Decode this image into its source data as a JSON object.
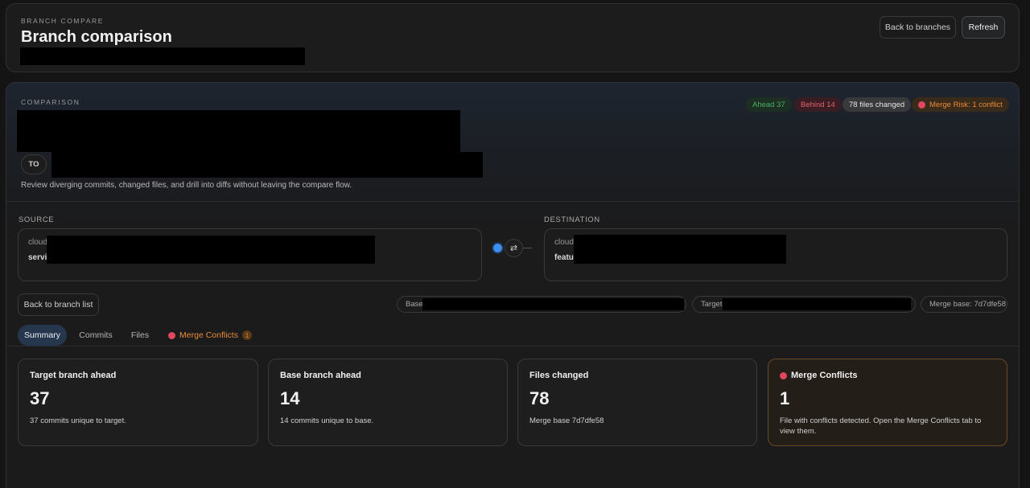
{
  "header": {
    "eyebrow": "BRANCH COMPARE",
    "title": "Branch comparison",
    "back_label": "Back to branches",
    "refresh_label": "Refresh"
  },
  "comparison": {
    "eyebrow": "COMPARISON",
    "to_label": "TO",
    "description": "Review diverging commits, changed files, and drill into diffs without leaving the compare flow.",
    "badges": {
      "ahead": "Ahead 37",
      "behind": "Behind 14",
      "files_changed": "78 files changed",
      "merge_risk": "Merge Risk: 1 conflict"
    },
    "colors": {
      "ahead": "#4caf68",
      "behind": "#e0616e",
      "risk": "#e88a3a",
      "active_tab": "#26374d",
      "node": "#3a8ff0"
    }
  },
  "source": {
    "label": "SOURCE",
    "line1": "cloud",
    "line2": "servic"
  },
  "destination": {
    "label": "DESTINATION",
    "line1": "cloud-",
    "line2": "featur"
  },
  "swap_icon": "swap-icon",
  "toolbar": {
    "back_list_label": "Back to branch list",
    "base_label": "Base:",
    "target_label": "Target:",
    "merge_base": "Merge base: 7d7dfe58"
  },
  "tabs": [
    {
      "label": "Summary"
    },
    {
      "label": "Commits"
    },
    {
      "label": "Files"
    },
    {
      "label": "Merge Conflicts",
      "count": "1"
    }
  ],
  "cards": [
    {
      "title": "Target branch ahead",
      "value": "37",
      "desc": "37 commits unique to target."
    },
    {
      "title": "Base branch ahead",
      "value": "14",
      "desc": "14 commits unique to base."
    },
    {
      "title": "Files changed",
      "value": "78",
      "desc": "Merge base 7d7dfe58"
    },
    {
      "title": "Merge Conflicts",
      "value": "1",
      "desc": "File with conflicts detected. Open the Merge Conflicts tab to view them."
    }
  ]
}
